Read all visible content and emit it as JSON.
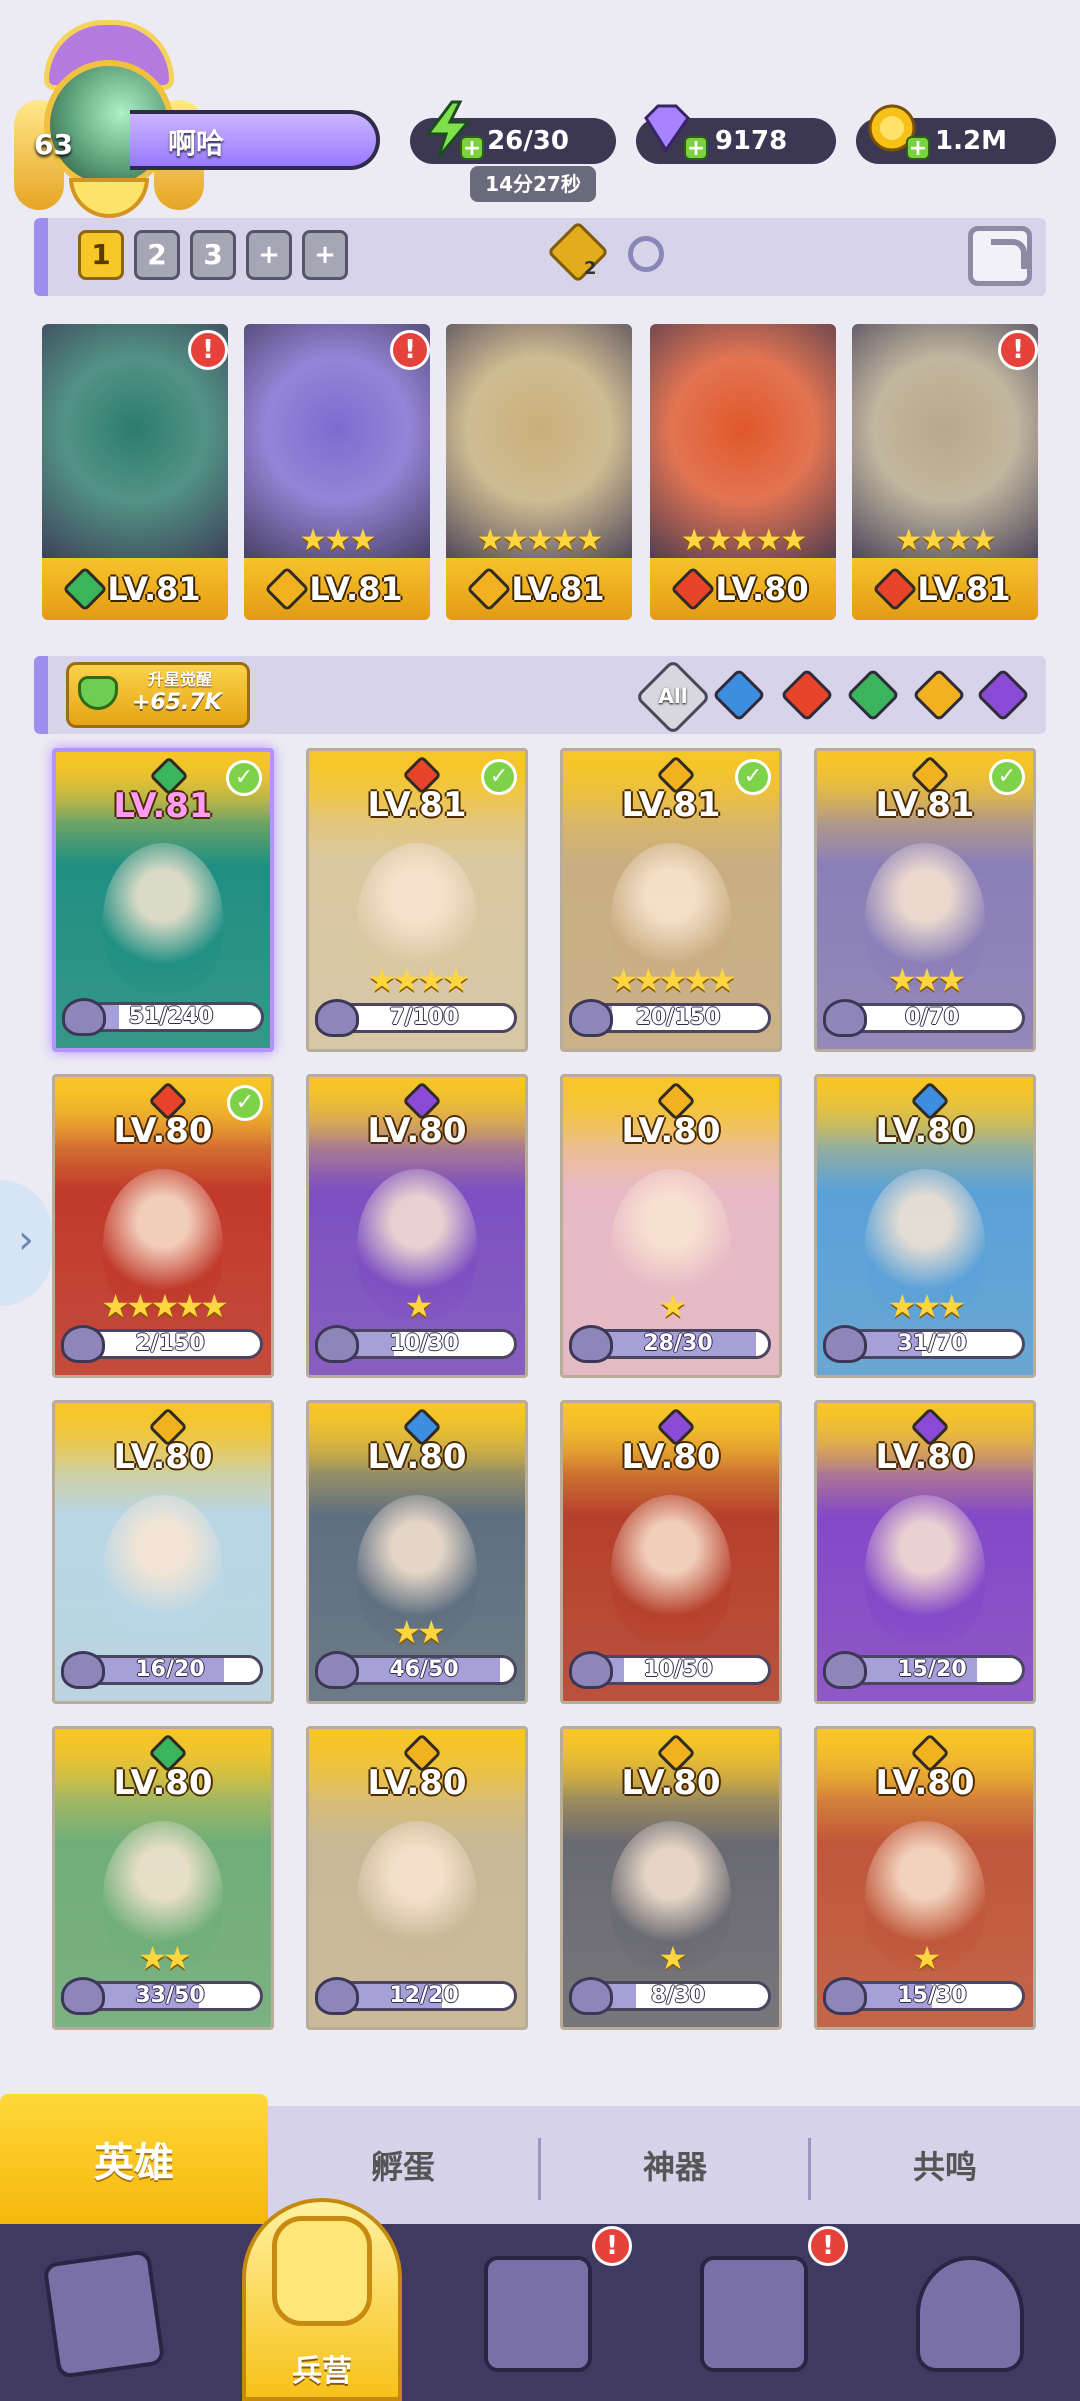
{
  "player": {
    "level": "63",
    "name": "啊哈"
  },
  "resources": {
    "energy": "26/30",
    "energy_timer": "14分27秒",
    "gems": "9178",
    "gold": "1.2M"
  },
  "team_slots": [
    "1",
    "2",
    "3",
    "+",
    "+"
  ],
  "team_slot_active": 0,
  "diamond_badge": "2",
  "team": [
    {
      "element": "wood",
      "level": "LV.81",
      "stars": "",
      "alert": "!",
      "color": "#2c7d6b"
    },
    {
      "element": "light",
      "level": "LV.81",
      "stars": "★★★",
      "alert": "!",
      "color": "#7f6bd0"
    },
    {
      "element": "light",
      "level": "LV.81",
      "stars": "★★★★★",
      "alert": "",
      "color": "#c8b07a"
    },
    {
      "element": "fire",
      "level": "LV.80",
      "stars": "★★★★★",
      "alert": "",
      "color": "#e0572a"
    },
    {
      "element": "fire",
      "level": "LV.81",
      "stars": "★★★★",
      "alert": "!",
      "color": "#b7a98a"
    }
  ],
  "awaken": {
    "title": "升星觉醒",
    "value": "+65.7K"
  },
  "filters": {
    "all_label": "All",
    "elements": [
      "water",
      "fire",
      "wood",
      "light",
      "dark"
    ],
    "colors": {
      "water": "#3d8ee0",
      "fire": "#e8442a",
      "wood": "#3bb55c",
      "light": "#f2b11e",
      "dark": "#8c4bd6"
    }
  },
  "heroes": [
    {
      "element": "wood",
      "level": "LV.81",
      "checked": true,
      "stars": "",
      "progress": "51/240",
      "fraction": 0.2125,
      "color": "#1f8f82",
      "special": true
    },
    {
      "element": "fire",
      "level": "LV.81",
      "checked": true,
      "stars": "★★★★",
      "progress": "7/100",
      "fraction": 0.07,
      "color": "#d9c7a2"
    },
    {
      "element": "light",
      "level": "LV.81",
      "checked": true,
      "stars": "★★★★★",
      "progress": "20/150",
      "fraction": 0.133,
      "color": "#c9ae82"
    },
    {
      "element": "light",
      "level": "LV.81",
      "checked": true,
      "stars": "★★★",
      "progress": "0/70",
      "fraction": 0,
      "color": "#8a7fb8"
    },
    {
      "element": "fire",
      "level": "LV.80",
      "checked": true,
      "stars": "★★★★★",
      "progress": "2/150",
      "fraction": 0.013,
      "color": "#c1392b"
    },
    {
      "element": "dark",
      "level": "LV.80",
      "checked": false,
      "stars": "★",
      "progress": "10/30",
      "fraction": 0.333,
      "color": "#7d4fc2"
    },
    {
      "element": "light",
      "level": "LV.80",
      "checked": false,
      "stars": "★",
      "progress": "28/30",
      "fraction": 0.933,
      "color": "#e7b9c6"
    },
    {
      "element": "water",
      "level": "LV.80",
      "checked": false,
      "stars": "★★★",
      "progress": "31/70",
      "fraction": 0.443,
      "color": "#5aa1d8"
    },
    {
      "element": "light",
      "level": "LV.80",
      "checked": false,
      "stars": "",
      "progress": "16/20",
      "fraction": 0.8,
      "color": "#b8d6e6"
    },
    {
      "element": "water",
      "level": "LV.80",
      "checked": false,
      "stars": "★★",
      "progress": "46/50",
      "fraction": 0.92,
      "color": "#5e6f80"
    },
    {
      "element": "dark",
      "level": "LV.80",
      "checked": false,
      "stars": "",
      "progress": "10/50",
      "fraction": 0.2,
      "color": "#b6402c"
    },
    {
      "element": "dark",
      "level": "LV.80",
      "checked": false,
      "stars": "",
      "progress": "15/20",
      "fraction": 0.75,
      "color": "#8448c8"
    },
    {
      "element": "wood",
      "level": "LV.80",
      "checked": false,
      "stars": "★★",
      "progress": "33/50",
      "fraction": 0.66,
      "color": "#6fae7a"
    },
    {
      "element": "light",
      "level": "LV.80",
      "checked": false,
      "stars": "",
      "progress": "12/20",
      "fraction": 0.6,
      "color": "#c9b896"
    },
    {
      "element": "light",
      "level": "LV.80",
      "checked": false,
      "stars": "★",
      "progress": "8/30",
      "fraction": 0.267,
      "color": "#6a6a72"
    },
    {
      "element": "light",
      "level": "LV.80",
      "checked": false,
      "stars": "★",
      "progress": "15/30",
      "fraction": 0.5,
      "color": "#c0573a"
    }
  ],
  "subtabs": [
    "英雄",
    "孵蛋",
    "神器",
    "共鸣"
  ],
  "nav": {
    "active_label": "兵营",
    "items": [
      "cards-icon",
      "barracks-icon",
      "map-icon",
      "shrine-icon",
      "mushroom-icon"
    ],
    "alerts": [
      "!",
      "!"
    ]
  }
}
